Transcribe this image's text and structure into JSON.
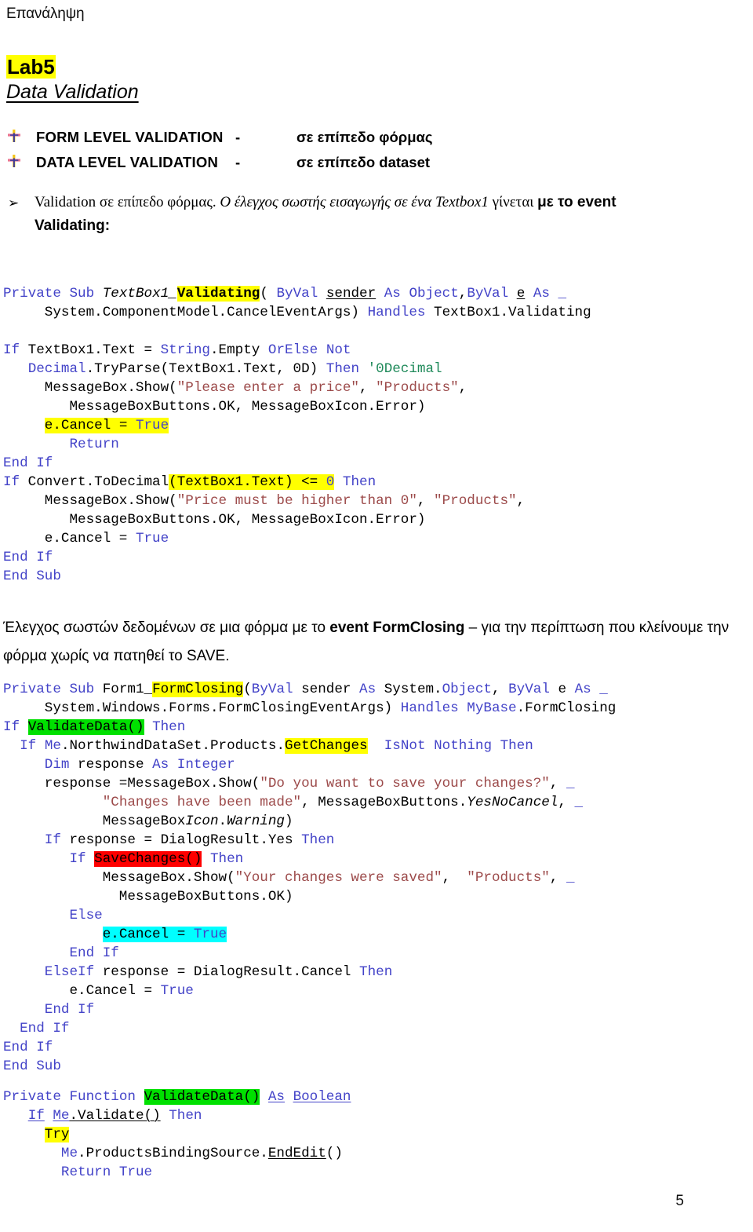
{
  "header": {
    "running_head": "Επανάληψη"
  },
  "titles": {
    "lab": "Lab5",
    "subtitle": "Data Validation"
  },
  "bullets": [
    {
      "icon": "cross-bullet-icon",
      "label": "FORM LEVEL VALIDATION",
      "dash": "-",
      "right": "σε επίπεδο φόρμας"
    },
    {
      "icon": "cross-bullet-icon",
      "label": "DATA LEVEL VALIDATION",
      "dash": "-",
      "right": "σε επίπεδο dataset"
    }
  ],
  "paragraph1": {
    "arrow": "➢",
    "part_plain": "Validation σε επίπεδο φόρμας.",
    "part_italic": " Ο έλεγχος σωστής  εισαγωγής σε ένα Textbox1",
    "part_italic2": "  γίνεται ",
    "part_bold": "με το event",
    "line2_bold": "Validating:"
  },
  "paragraph2": {
    "text_before": "Έλεγχος σωστών  δεδομένων σε μια φόρμα με το ",
    "text_bold": "event FormClosing",
    "text_after": " – για την περίπτωση που κλείνουμε την φόρμα χωρίς να πατηθεί το SAVE."
  },
  "code_block_1": {
    "name": "TextBox1_Validating handler",
    "lines": [
      "Private Sub TextBox1_Validating( ByVal sender As Object,ByVal e As _",
      "     System.ComponentModel.CancelEventArgs) Handles TextBox1.Validating",
      "",
      "If TextBox1.Text = String.Empty OrElse Not",
      "   Decimal.TryParse(TextBox1.Text, 0D) Then '0Decimal",
      "     MessageBox.Show(\"Please enter a price\", \"Products\",",
      "        MessageBoxButtons.OK, MessageBoxIcon.Error)",
      "     e.Cancel = True",
      "        Return",
      "End If",
      "If Convert.ToDecimal(TextBox1.Text) <= 0 Then",
      "     MessageBox.Show(\"Price must be higher than 0\", \"Products\",",
      "        MessageBoxButtons.OK, MessageBoxIcon.Error)",
      "     e.Cancel = True",
      "End If",
      "End Sub"
    ]
  },
  "code_block_2": {
    "name": "Form1_FormClosing handler",
    "lines": [
      "Private Sub Form1_FormClosing(ByVal sender As System.Object, ByVal e As _",
      "     System.Windows.Forms.FormClosingEventArgs) Handles MyBase.FormClosing",
      "If ValidateData() Then",
      "  If Me.NorthwindDataSet.Products.GetChanges  IsNot Nothing Then",
      "     Dim response As Integer",
      "     response =MessageBox.Show(\"Do you want to save your changes?\", _",
      "            \"Changes have been made\", MessageBoxButtons.YesNoCancel, _",
      "            MessageBoxIcon.Warning)",
      "     If response = DialogResult.Yes Then",
      "        If SaveChanges() Then",
      "            MessageBox.Show(\"Your changes were saved\",  \"Products\", _",
      "              MessageBoxButtons.OK)",
      "        Else",
      "            e.Cancel = True",
      "        End If",
      "     ElseIf response = DialogResult.Cancel Then",
      "        e.Cancel = True",
      "     End If",
      "  End If",
      "End If",
      "End Sub"
    ]
  },
  "code_block_3": {
    "name": "ValidateData function",
    "lines": [
      "Private Function ValidateData() As Boolean",
      "   If Me.Validate() Then",
      "     Try",
      "       Me.ProductsBindingSource.EndEdit()",
      "       Return True"
    ]
  },
  "footer": {
    "page_number": "5"
  },
  "colors": {
    "keyword": "#4343c8",
    "string": "#9c4a4a",
    "comment": "#1f8a5a",
    "highlight_yellow": "#ffff00",
    "highlight_green": "#00e000",
    "highlight_red": "#ff0000",
    "highlight_cyan": "#00ffff"
  }
}
